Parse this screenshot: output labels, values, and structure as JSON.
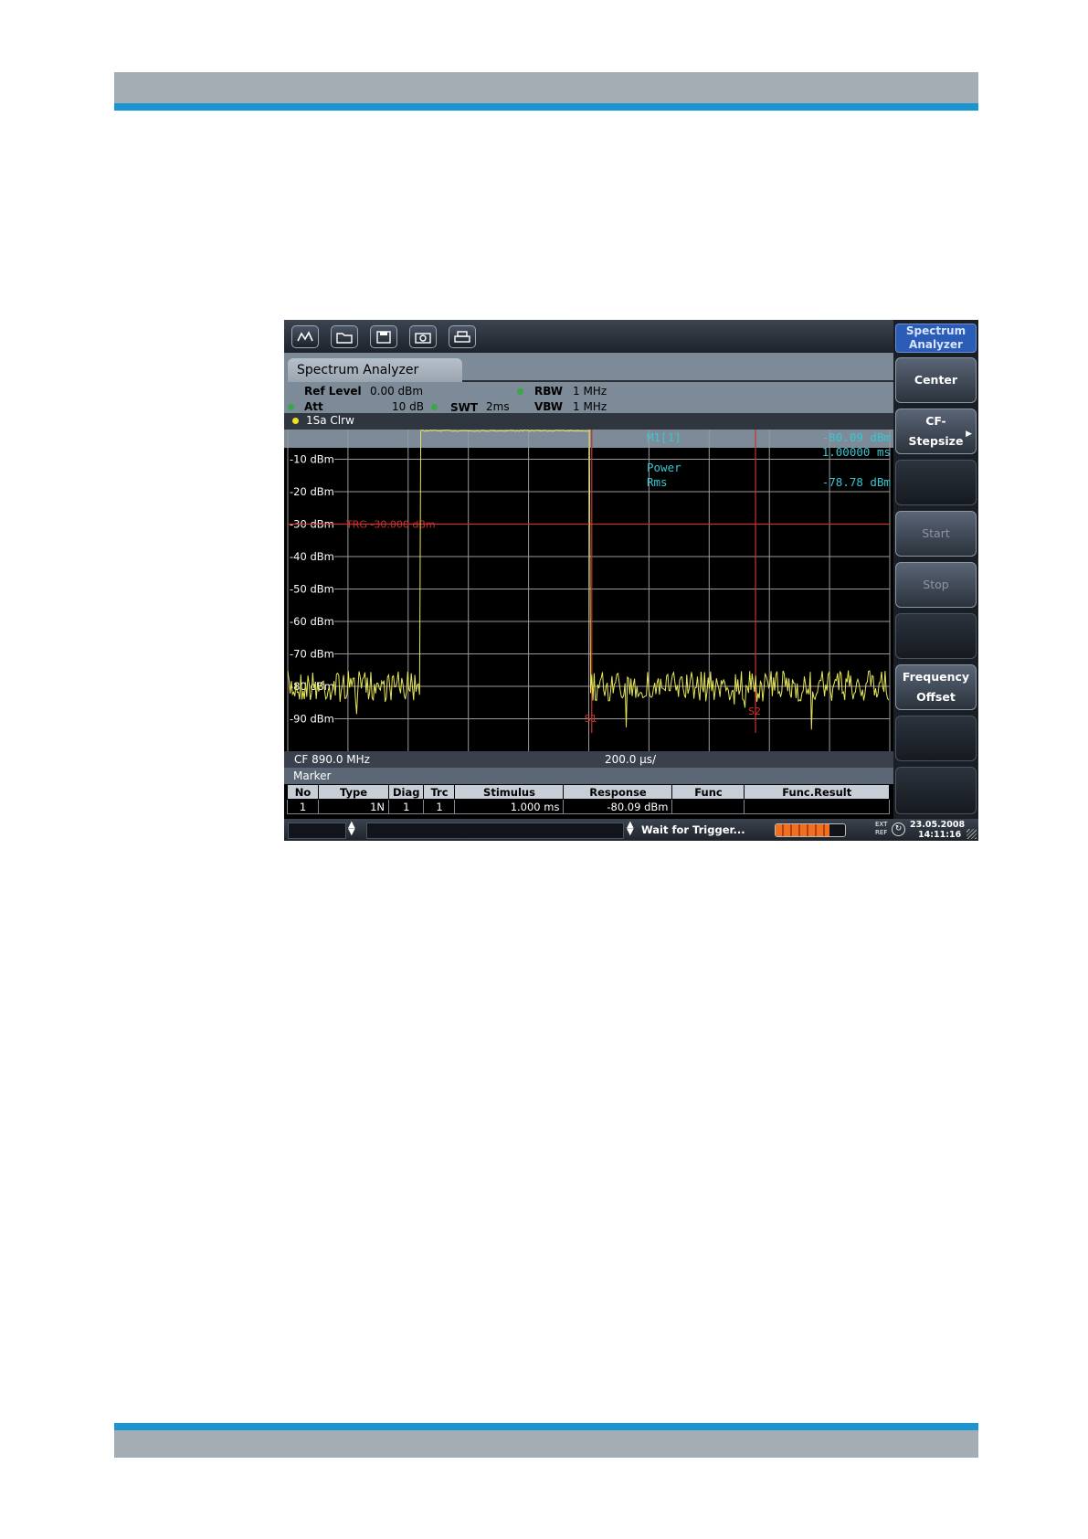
{
  "toolbar": {
    "icons": [
      "marker-icon",
      "open-folder-icon",
      "save-icon",
      "camera-icon",
      "print-icon"
    ]
  },
  "mode_button": {
    "line1": "Spectrum",
    "line2": "Analyzer"
  },
  "softkeys": {
    "center": "Center",
    "cf_stepsize_1": "CF-",
    "cf_stepsize_2": "Stepsize",
    "start": "Start",
    "stop": "Stop",
    "freq_offset_1": "Frequency",
    "freq_offset_2": "Offset"
  },
  "header": {
    "tab_title": "Spectrum Analyzer",
    "ref_level_label": "Ref Level",
    "ref_level_value": "0.00 dBm",
    "att_label": "Att",
    "att_value": "10 dB",
    "swt_label": "SWT",
    "swt_value": "2ms",
    "rbw_label": "RBW",
    "rbw_value": "1 MHz",
    "vbw_label": "VBW",
    "vbw_value": "1 MHz",
    "trace_info": "1Sa Clrw"
  },
  "chart_data": {
    "type": "line",
    "y_ticks": [
      "-10 dBm",
      "-20 dBm",
      "-30 dBm",
      "-40 dBm",
      "-50 dBm",
      "-60 dBm",
      "-70 dBm",
      "-80 dBm",
      "-90 dBm"
    ],
    "ylim": [
      -100,
      0
    ],
    "x_label_left": "CF 890.0 MHz",
    "x_label_center": "200.0 µs/",
    "trigger_line": {
      "level_dBm": -30,
      "label": "TRG -30.000 dBm"
    },
    "lines": [
      {
        "label": "S1",
        "x_fraction": 0.505
      },
      {
        "label": "S2",
        "x_fraction": 0.777
      }
    ],
    "burst": {
      "start_fraction": 0.215,
      "end_fraction": 0.505,
      "level_dBm": -1
    },
    "noise_floor_dBm": -80,
    "marker": {
      "name": "M1[1]",
      "level": "-80.09 dBm",
      "time": "1.00000 ms",
      "power_label": "Power",
      "rms_label": "Rms",
      "rms_value": "-78.78 dBm"
    },
    "grid": true,
    "colors": {
      "trace": "#e6e65a",
      "grid": "#9a9a9a",
      "trigger": "#c8322d",
      "marker_text": "#37c8d2"
    }
  },
  "marker_table": {
    "title": "Marker",
    "headers": [
      "No",
      "Type",
      "Diag",
      "Trc",
      "Stimulus",
      "Response",
      "Func",
      "Func.Result"
    ],
    "rows": [
      [
        "1",
        "1N",
        "1",
        "1",
        "1.000 ms",
        "-80.09 dBm",
        "",
        ""
      ]
    ]
  },
  "status": {
    "message": "Wait for Trigger...",
    "ext_ref": "EXT REF",
    "date": "23.05.2008",
    "time": "14:11:16"
  }
}
